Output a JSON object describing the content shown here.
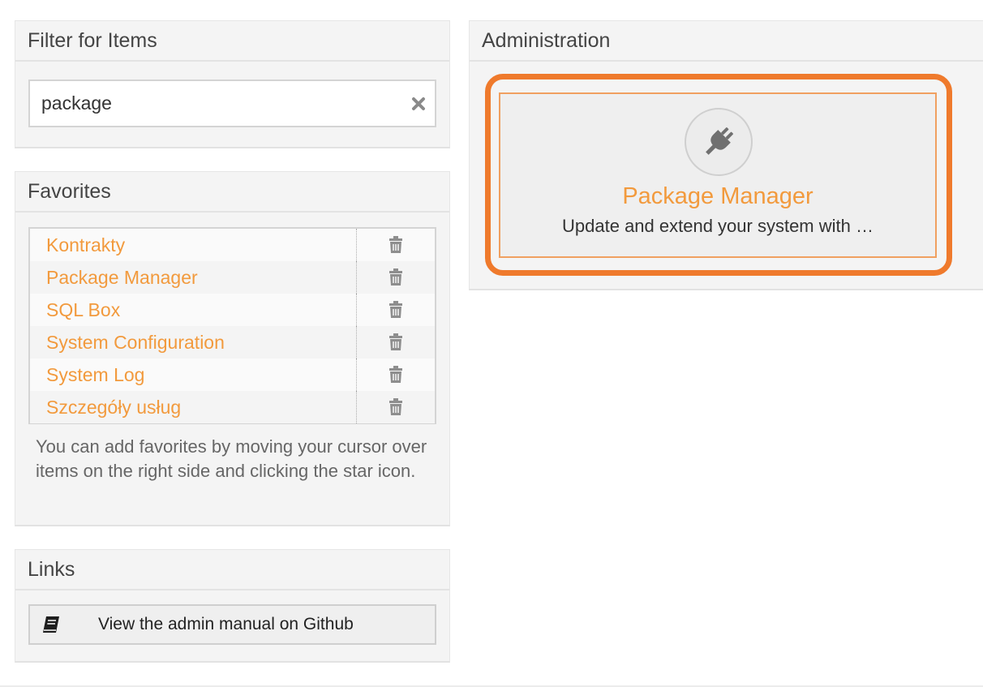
{
  "filter": {
    "title": "Filter for Items",
    "value": "package",
    "clear_icon": "close-icon"
  },
  "favorites": {
    "title": "Favorites",
    "items": [
      {
        "label": "Kontrakty"
      },
      {
        "label": "Package Manager"
      },
      {
        "label": "SQL Box"
      },
      {
        "label": "System Configuration"
      },
      {
        "label": "System Log"
      },
      {
        "label": "Szczegóły usług"
      }
    ],
    "delete_icon": "trash-icon",
    "hint": "You can add favorites by moving your cursor over items on the right side and clicking the star icon."
  },
  "links": {
    "title": "Links",
    "manual_label": "View the admin manual on Github",
    "manual_icon": "book-icon"
  },
  "administration": {
    "title": "Administration",
    "item": {
      "title": "Package Manager",
      "description": "Update and extend your system with …",
      "icon": "plug-icon"
    }
  },
  "colors": {
    "accent": "#f29a3d",
    "highlight": "#ef7a2c",
    "panel_bg": "#f4f4f4"
  }
}
